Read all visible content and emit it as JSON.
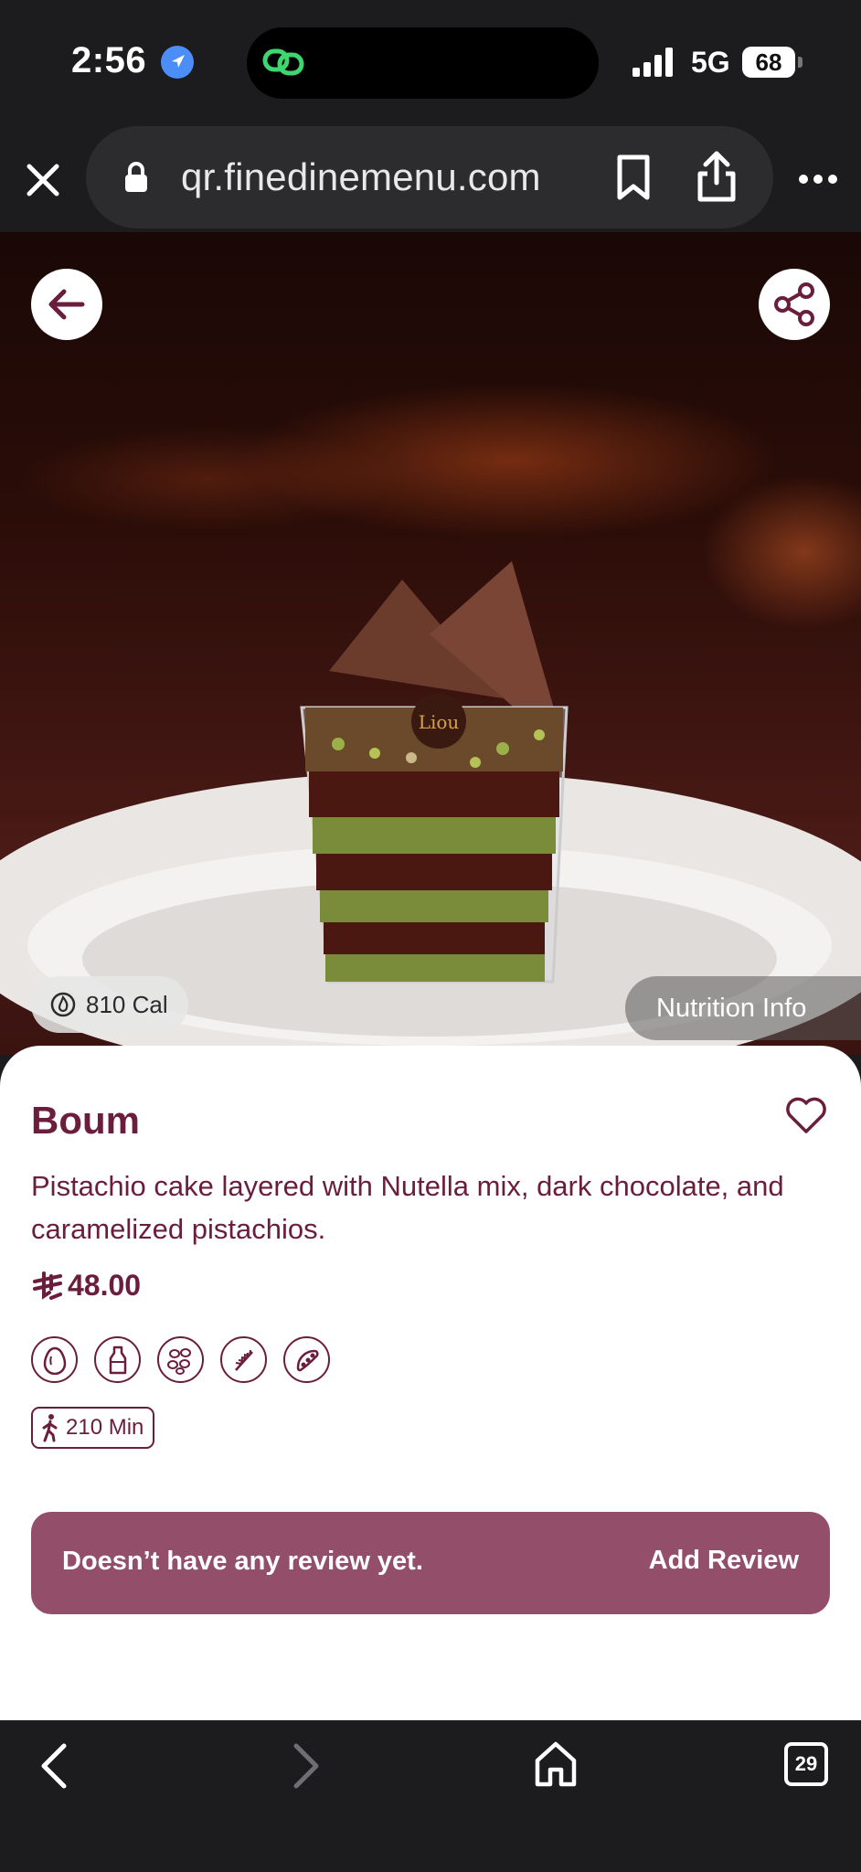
{
  "status_bar": {
    "time": "2:56",
    "network": "5G",
    "battery": "68"
  },
  "browser": {
    "url": "qr.finedinemenu.com"
  },
  "hero": {
    "calories": "810 Cal",
    "nutrition_label": "Nutrition Info"
  },
  "product": {
    "name": "Boum",
    "description": "Pistachio cake layered with Nutella mix, dark chocolate, and caramelized pistachios.",
    "price": "48.00",
    "allergens": [
      "egg-icon",
      "milk-icon",
      "nuts-icon",
      "gluten-icon",
      "soy-icon"
    ],
    "prep_time": "210 Min"
  },
  "reviews": {
    "status": "Doesn’t have any review yet.",
    "add_label": "Add Review"
  },
  "toolbar": {
    "tab_count": "29"
  },
  "colors": {
    "brand": "#6b1d3c",
    "review_bar": "#934e6a"
  }
}
